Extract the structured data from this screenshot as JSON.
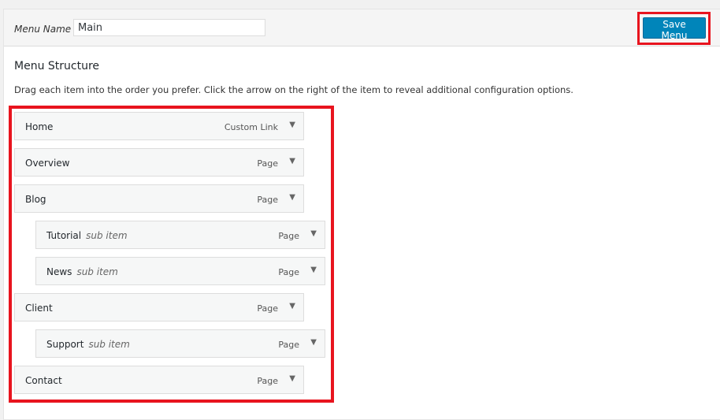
{
  "header": {
    "menu_name_label": "Menu Name",
    "menu_name_value": "Main",
    "save_label": "Save Menu",
    "save_color": "#0085ba"
  },
  "structure": {
    "title": "Menu Structure",
    "description": "Drag each item into the order you prefer. Click the arrow on the right of the item to reveal additional configuration options."
  },
  "items": [
    {
      "title": "Home",
      "sub": "",
      "type": "Custom Link",
      "depth": 0
    },
    {
      "title": "Overview",
      "sub": "",
      "type": "Page",
      "depth": 0
    },
    {
      "title": "Blog",
      "sub": "",
      "type": "Page",
      "depth": 0
    },
    {
      "title": "Tutorial",
      "sub": "sub item",
      "type": "Page",
      "depth": 1
    },
    {
      "title": "News",
      "sub": "sub item",
      "type": "Page",
      "depth": 1
    },
    {
      "title": "Client",
      "sub": "",
      "type": "Page",
      "depth": 0
    },
    {
      "title": "Support",
      "sub": "sub item",
      "type": "Page",
      "depth": 1
    },
    {
      "title": "Contact",
      "sub": "",
      "type": "Page",
      "depth": 0
    }
  ],
  "icons": {
    "expand": "triangle-down-icon"
  },
  "highlight_color": "#e8141e"
}
